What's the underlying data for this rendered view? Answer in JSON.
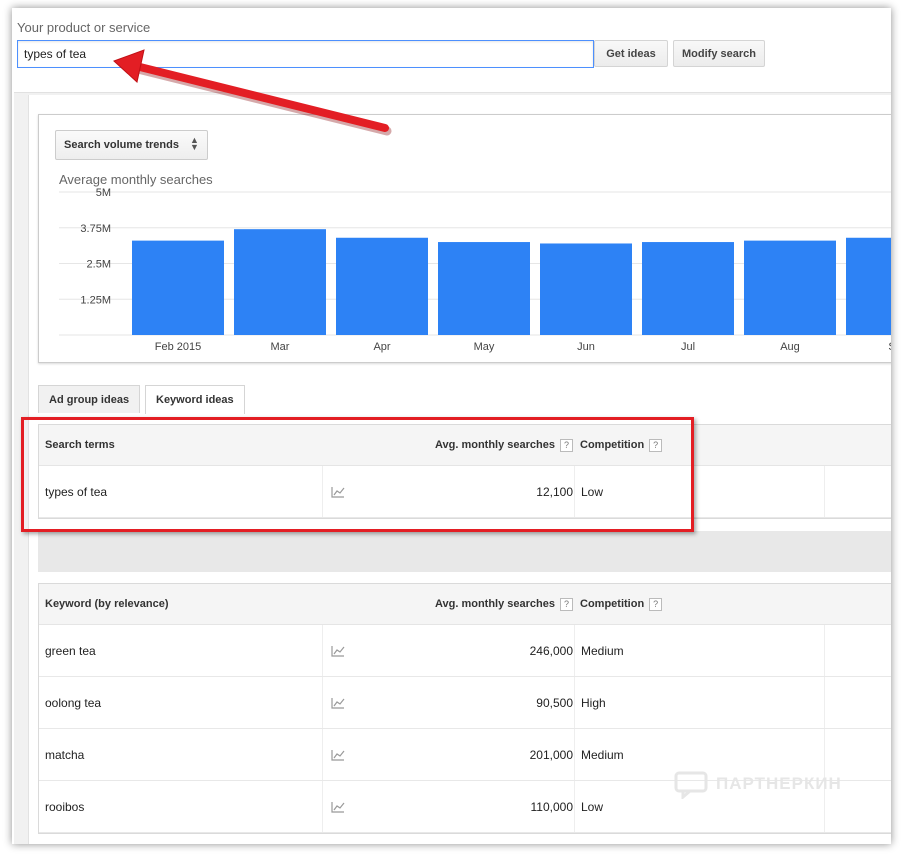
{
  "search": {
    "label": "Your product or service",
    "value": "types of tea",
    "get_ideas_label": "Get ideas",
    "modify_search_label": "Modify search"
  },
  "chart": {
    "selector_label": "Search volume trends",
    "title": "Average monthly searches"
  },
  "chart_data": {
    "type": "bar",
    "title": "Average monthly searches",
    "categories": [
      "Feb 2015",
      "Mar",
      "Apr",
      "May",
      "Jun",
      "Jul",
      "Aug",
      "S"
    ],
    "values": [
      3300000,
      3700000,
      3400000,
      3250000,
      3200000,
      3250000,
      3300000,
      3400000
    ],
    "y_ticks": [
      "5M",
      "3.75M",
      "2.5M",
      "1.25M"
    ],
    "ylim": [
      0,
      5000000
    ],
    "grid": true,
    "bar_color": "#2d82f5"
  },
  "tabs": [
    {
      "label": "Ad group ideas",
      "active": false
    },
    {
      "label": "Keyword ideas",
      "active": true
    }
  ],
  "search_terms_table": {
    "headers": {
      "term": "Search terms",
      "volume": "Avg. monthly searches",
      "competition": "Competition",
      "help": "?"
    },
    "rows": [
      {
        "term": "types of tea",
        "volume": "12,100",
        "competition": "Low"
      }
    ]
  },
  "keyword_table": {
    "headers": {
      "term": "Keyword (by relevance)",
      "volume": "Avg. monthly searches",
      "competition": "Competition",
      "help": "?"
    },
    "rows": [
      {
        "term": "green tea",
        "volume": "246,000",
        "competition": "Medium"
      },
      {
        "term": "oolong tea",
        "volume": "90,500",
        "competition": "High"
      },
      {
        "term": "matcha",
        "volume": "201,000",
        "competition": "Medium"
      },
      {
        "term": "rooibos",
        "volume": "110,000",
        "competition": "Low"
      }
    ]
  },
  "watermark": "ПАРТНЕРКИН",
  "colors": {
    "accent": "#2d82f5",
    "highlight": "#e31e24"
  }
}
